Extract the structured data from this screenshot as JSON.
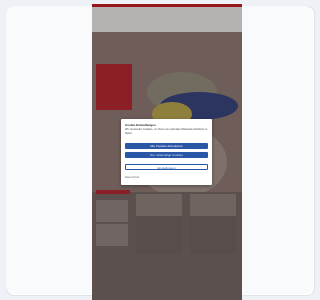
{
  "dialog": {
    "title": "Cookie-Einstellungen",
    "body": "Wir verwenden Cookies, um Ihnen ein optimales Webseiten-Erlebnis zu bieten.",
    "accept_all": "Alle Cookies akzeptieren",
    "necessary_only": "Nur notwendige Cookies",
    "settings": "Einstellungen",
    "privacy_link": "Datenschutz"
  },
  "site": {
    "logo": "",
    "nav": [
      "",
      "",
      ""
    ],
    "hero_text": "",
    "tiles": [
      {
        "text": ""
      },
      {
        "text": ""
      }
    ]
  },
  "colors": {
    "brand_red": "#c4161c",
    "button_blue": "#2a56a6",
    "backdrop": "#7a6a63"
  }
}
